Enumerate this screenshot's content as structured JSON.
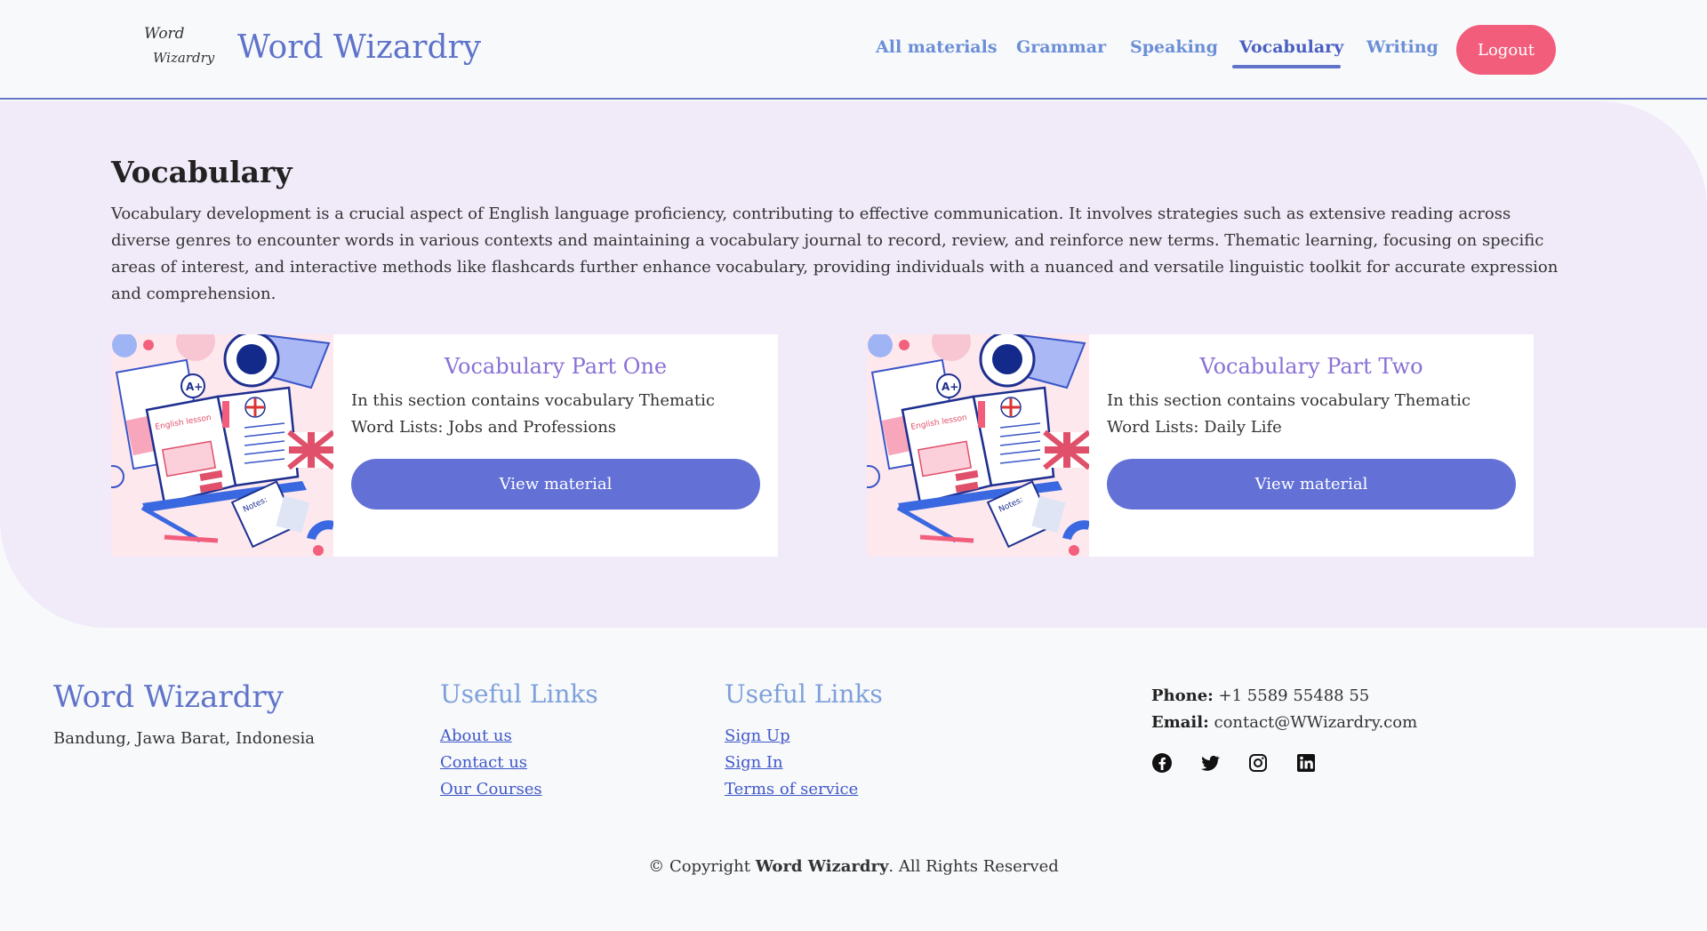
{
  "header": {
    "logo_line1": "Word",
    "logo_line2": "Wizardry",
    "brand": "Word Wizardry",
    "nav": [
      {
        "label": "All materials"
      },
      {
        "label": "Grammar"
      },
      {
        "label": "Speaking"
      },
      {
        "label": "Vocabulary",
        "active": true
      },
      {
        "label": "Writing"
      }
    ],
    "logout_label": "Logout"
  },
  "main": {
    "title": "Vocabulary",
    "intro": "Vocabulary development is a crucial aspect of English language proficiency, contributing to effective communication. It involves strategies such as extensive reading across diverse genres to encounter words in various contexts and maintaining a vocabulary journal to record, review, and reinforce new terms. Thematic learning, focusing on specific areas of interest, and interactive methods like flashcards further enhance vocabulary, providing individuals with a nuanced and versatile linguistic toolkit for accurate expression and comprehension.",
    "cards": [
      {
        "title": "Vocabulary Part One",
        "description": "In this section contains vocabulary Thematic Word Lists: Jobs and Professions",
        "button": "View material",
        "image_label_grade": "A+",
        "image_label_book": "English lesson",
        "image_label_notes": "Notes:"
      },
      {
        "title": "Vocabulary Part Two",
        "description": "In this section contains vocabulary Thematic Word Lists: Daily Life",
        "button": "View material",
        "image_label_grade": "A+",
        "image_label_book": "English lesson",
        "image_label_notes": "Notes:"
      }
    ]
  },
  "footer": {
    "brand": "Word Wizardry",
    "address": "Bandung, Jawa Barat, Indonesia",
    "columns": [
      {
        "heading": "Useful Links",
        "links": [
          "About us",
          "Contact us",
          "Our Courses"
        ]
      },
      {
        "heading": "Useful Links",
        "links": [
          "Sign Up",
          "Sign In",
          "Terms of service"
        ]
      }
    ],
    "phone_label": "Phone:",
    "phone": "+1 5589 55488 55",
    "email_label": "Email:",
    "email": "contact@WWizardry.com",
    "socials": [
      "facebook-icon",
      "twitter-icon",
      "instagram-icon",
      "linkedin-icon"
    ],
    "copyright_prefix": "© Copyright ",
    "copyright_brand": "Word Wizardry",
    "copyright_suffix": ". All Rights Reserved"
  },
  "colors": {
    "brand": "#5f73c9",
    "nav": "#6b8fd6",
    "logout": "#f25d7b",
    "main_bg": "#f1eaf9",
    "button": "#6371d6",
    "card_title": "#8a70d4",
    "link": "#4058c8"
  }
}
